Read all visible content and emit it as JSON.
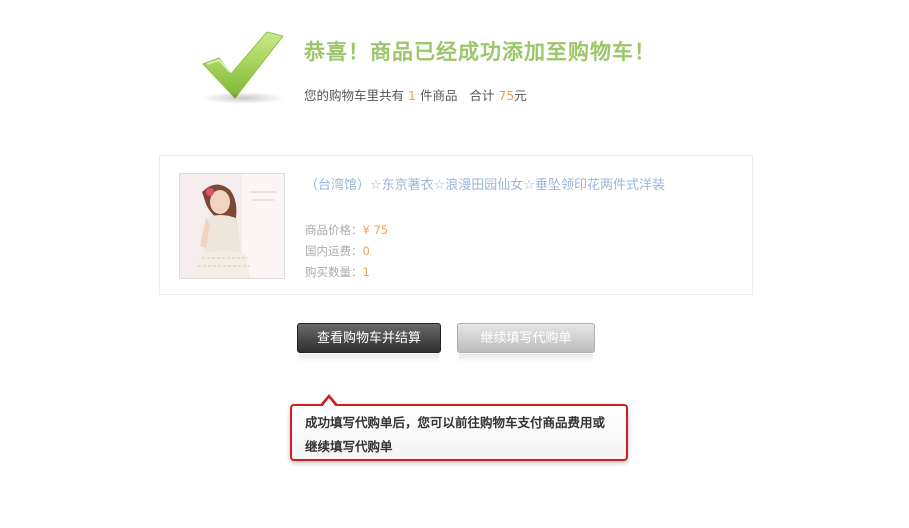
{
  "headline": "恭喜！商品已经成功添加至购物车！",
  "summary": {
    "prefix": "您的购物车里共有",
    "count": "1",
    "count_suffix": "件商品",
    "total_label": "合计",
    "total_amount": "75",
    "total_unit": "元"
  },
  "product": {
    "title": "（台湾馆）☆东京著衣☆浪漫田园仙女☆垂坠领印花两件式洋装",
    "price_label": "商品价格：",
    "price_value": "¥ 75",
    "shipping_label": "国内运费：",
    "shipping_value": "0",
    "quantity_label": "购买数量：",
    "quantity_value": "1"
  },
  "buttons": {
    "view_cart": "查看购物车并结算",
    "continue": "继续填写代购单"
  },
  "tooltip": {
    "text": "成功填写代购单后，您可以前往购物车支付商品费用或继续填写代购单"
  },
  "colors": {
    "accent_green": "#9cc66a",
    "highlight_orange": "#f0a050",
    "link_blue": "#9ab6d8",
    "tooltip_border": "#cc1f1f"
  },
  "icons": {
    "success": "check-mark-icon"
  }
}
